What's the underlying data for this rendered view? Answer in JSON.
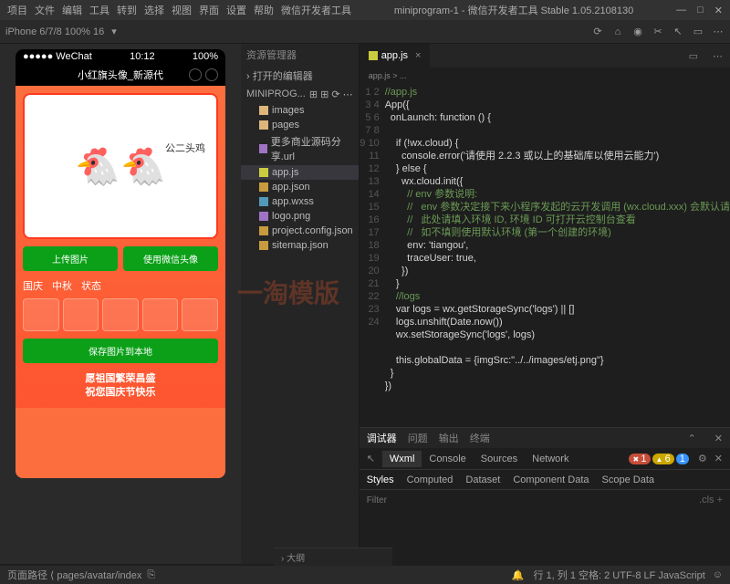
{
  "menu": [
    "项目",
    "文件",
    "编辑",
    "工具",
    "转到",
    "选择",
    "视图",
    "界面",
    "设置",
    "帮助",
    "微信开发者工具"
  ],
  "title_mid": "miniprogram-1 - 微信开发者工具 Stable 1.05.2108130",
  "toolbar": {
    "device": "iPhone 6/7/8 100% 16"
  },
  "phone": {
    "statusbar": {
      "carrier": "●●●●● WeChat",
      "time": "10:12",
      "batt": "100%"
    },
    "nav": "小红旗头像_新源代",
    "card_label": "公二头鸡",
    "btn_upload": "上传图片",
    "btn_wx": "使用微信头像",
    "tabs": [
      "国庆",
      "中秋",
      "状态"
    ],
    "save": "保存图片到本地",
    "wish1": "愿祖国繁荣昌盛",
    "wish2": "祝您国庆节快乐"
  },
  "explorer": {
    "title": "资源管理器",
    "open": "› 打开的编辑器",
    "root": "MINIPROG...",
    "items": [
      {
        "icon": "fold",
        "label": "images"
      },
      {
        "icon": "fold",
        "label": "pages"
      },
      {
        "icon": "img",
        "label": "更多商业源码分享.url"
      },
      {
        "icon": "js",
        "label": "app.js",
        "sel": true
      },
      {
        "icon": "json",
        "label": "app.json"
      },
      {
        "icon": "css",
        "label": "app.wxss"
      },
      {
        "icon": "img",
        "label": "logo.png"
      },
      {
        "icon": "json",
        "label": "project.config.json"
      },
      {
        "icon": "json",
        "label": "sitemap.json"
      }
    ],
    "outline": "› 大纲"
  },
  "editor": {
    "tab": "app.js",
    "bread": "app.js > ...",
    "code": [
      {
        "t": "//app.js",
        "c": "com"
      },
      {
        "t": "App({",
        "c": ""
      },
      {
        "t": "  onLaunch: function () {",
        "c": ""
      },
      {
        "t": "",
        "c": ""
      },
      {
        "t": "    if (!wx.cloud) {",
        "c": ""
      },
      {
        "t": "      console.error('请使用 2.2.3 或以上的基础库以使用云能力')",
        "c": ""
      },
      {
        "t": "    } else {",
        "c": ""
      },
      {
        "t": "      wx.cloud.init({",
        "c": ""
      },
      {
        "t": "        // env 参数说明:",
        "c": "com"
      },
      {
        "t": "        //   env 参数决定接下来小程序发起的云开发调用 (wx.cloud.xxx) 会默认请",
        "c": "com"
      },
      {
        "t": "        //   此处请填入环境 ID, 环境 ID 可打开云控制台查看",
        "c": "com"
      },
      {
        "t": "        //   如不填则使用默认环境 (第一个创建的环境)",
        "c": "com"
      },
      {
        "t": "        env: 'tiangou',",
        "c": ""
      },
      {
        "t": "        traceUser: true,",
        "c": ""
      },
      {
        "t": "      })",
        "c": ""
      },
      {
        "t": "    }",
        "c": ""
      },
      {
        "t": "    //logs",
        "c": "com"
      },
      {
        "t": "    var logs = wx.getStorageSync('logs') || []",
        "c": ""
      },
      {
        "t": "    logs.unshift(Date.now())",
        "c": ""
      },
      {
        "t": "    wx.setStorageSync('logs', logs)",
        "c": ""
      },
      {
        "t": "",
        "c": ""
      },
      {
        "t": "    this.globalData = {imgSrc:\"../../images/etj.png\"}",
        "c": ""
      },
      {
        "t": "  }",
        "c": ""
      },
      {
        "t": "})",
        "c": ""
      }
    ]
  },
  "debug": {
    "hd": [
      "调试器",
      "问题",
      "输出",
      "终端"
    ],
    "tabs": [
      "Wxml",
      "Console",
      "Sources",
      "Network"
    ],
    "badges": {
      "e": "1",
      "w": "6",
      "i": "1"
    },
    "sub": [
      "Styles",
      "Computed",
      "Dataset",
      "Component Data",
      "Scope Data"
    ],
    "filter": "Filter",
    "cls": ".cls  +"
  },
  "status": {
    "left": "页面路径  ⟨  pages/avatar/index",
    "right": "行 1, 列 1   空格: 2   UTF-8   LF   JavaScript"
  },
  "watermark": "一淘模版"
}
